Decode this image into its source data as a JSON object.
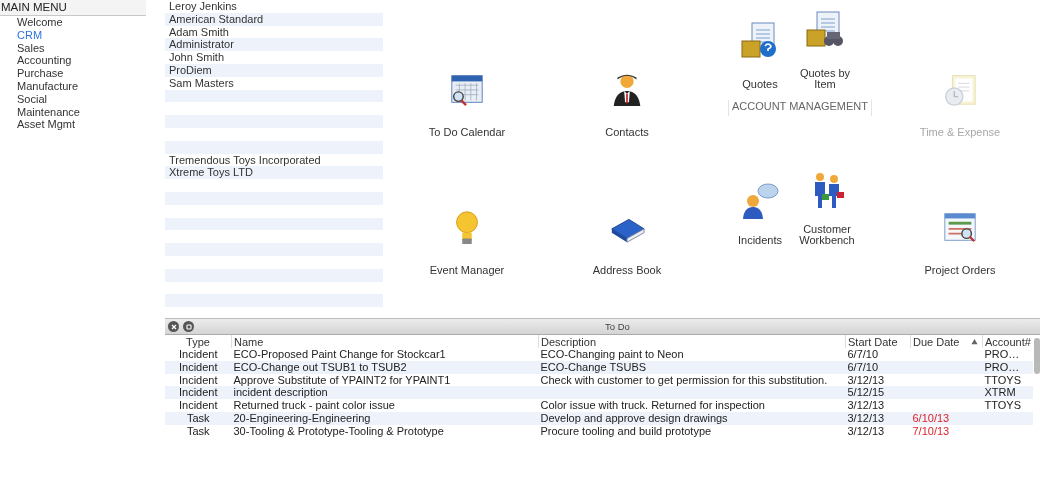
{
  "sidebar": {
    "header": "MAIN MENU",
    "items": [
      {
        "label": "Welcome",
        "selected": false
      },
      {
        "label": "CRM",
        "selected": true
      },
      {
        "label": "Sales",
        "selected": false
      },
      {
        "label": "Accounting",
        "selected": false
      },
      {
        "label": "Purchase",
        "selected": false
      },
      {
        "label": "Manufacture",
        "selected": false
      },
      {
        "label": "Social",
        "selected": false
      },
      {
        "label": "Maintenance",
        "selected": false
      },
      {
        "label": "Asset Mgmt",
        "selected": false
      }
    ]
  },
  "accounts": {
    "rows": [
      {
        "name": "Leroy Jenkins"
      },
      {
        "name": "American Standard"
      },
      {
        "name": "Adam Smith"
      },
      {
        "name": "Administrator"
      },
      {
        "name": "John Smith"
      },
      {
        "name": "ProDiem"
      },
      {
        "name": "Sam Masters"
      },
      {},
      {},
      {},
      {},
      {},
      {
        "name": "Tremendous Toys Incorporated"
      },
      {
        "name": "Xtreme Toys LTD"
      },
      {},
      {},
      {},
      {},
      {},
      {},
      {},
      {},
      {},
      {}
    ]
  },
  "launcher": {
    "tiles": [
      {
        "kind": "single",
        "label": "To Do Calendar",
        "disabled": false
      },
      {
        "kind": "single",
        "label": "Contacts",
        "disabled": false
      },
      {
        "kind": "group",
        "title": "ACCOUNT MANAGEMENT",
        "items": [
          {
            "label": "Quotes"
          },
          {
            "label": "Quotes by Item"
          }
        ]
      },
      {
        "kind": "single",
        "label": "Time & Expense",
        "disabled": true
      },
      {
        "kind": "single",
        "label": "Event Manager",
        "disabled": false
      },
      {
        "kind": "single",
        "label": "Address Book",
        "disabled": false
      },
      {
        "kind": "group",
        "items": [
          {
            "label": "Incidents"
          },
          {
            "label": "Customer Workbench"
          }
        ]
      },
      {
        "kind": "single",
        "label": "Project Orders",
        "disabled": false
      }
    ]
  },
  "todo": {
    "title": "To Do",
    "columns": [
      {
        "label": "Type",
        "sorted": false
      },
      {
        "label": "Name",
        "sorted": false
      },
      {
        "label": "Description",
        "sorted": false
      },
      {
        "label": "Start Date",
        "sorted": false
      },
      {
        "label": "Due Date",
        "sorted": true
      },
      {
        "label": "Account#",
        "sorted": false
      }
    ],
    "rows": [
      {
        "type": "Incident",
        "name": "ECO-Proposed Paint Change for Stockcar1",
        "description": "ECO-Changing paint to Neon",
        "start_date": "6/7/10",
        "account": "PRO…"
      },
      {
        "type": "Incident",
        "name": "ECO-Change out TSUB1 to TSUB2",
        "description": "ECO-Change TSUBS",
        "start_date": "6/7/10",
        "account": "PRO…"
      },
      {
        "type": "Incident",
        "name": "Approve Substitute of YPAINT2 for YPAINT1",
        "description": "Check with customer to get permission for this substitution.",
        "start_date": "3/12/13",
        "account": "TTOYS"
      },
      {
        "type": "Incident",
        "name": "incident description",
        "start_date": "5/12/15",
        "account": "XTRM"
      },
      {
        "type": "Incident",
        "name": "Returned truck - paint color issue",
        "description": "Color issue with truck.  Returned for inspection",
        "start_date": "3/12/13",
        "account": "TTOYS"
      },
      {
        "type": "Task",
        "name": "20-Engineering-Engineering",
        "description": "Develop and approve design drawings",
        "start_date": "3/12/13",
        "due_date": "6/10/13",
        "overdue": true
      },
      {
        "type": "Task",
        "name": "30-Tooling & Prototype-Tooling & Prototype",
        "description": "Procure tooling and build prototype",
        "start_date": "3/12/13",
        "due_date": "7/10/13",
        "overdue": true
      }
    ]
  }
}
